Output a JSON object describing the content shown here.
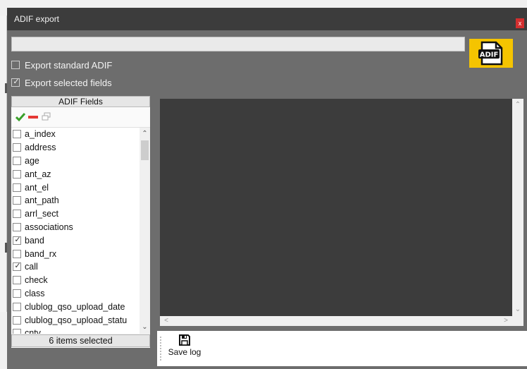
{
  "window": {
    "title": "ADIF export",
    "close_label": "x"
  },
  "logo": {
    "text": "ADIF"
  },
  "options": {
    "standard": {
      "label": "Export standard ADIF",
      "checked": false
    },
    "selected": {
      "label": "Export selected fields",
      "checked": true
    }
  },
  "fields": {
    "header": "ADIF Fields",
    "toolbar_icons": [
      "check-all-icon",
      "uncheck-all-icon",
      "copy-icon"
    ],
    "items": [
      {
        "label": "a_index",
        "checked": false
      },
      {
        "label": "address",
        "checked": false
      },
      {
        "label": "age",
        "checked": false
      },
      {
        "label": "ant_az",
        "checked": false
      },
      {
        "label": "ant_el",
        "checked": false
      },
      {
        "label": "ant_path",
        "checked": false
      },
      {
        "label": "arrl_sect",
        "checked": false
      },
      {
        "label": "associations",
        "checked": false
      },
      {
        "label": "band",
        "checked": true
      },
      {
        "label": "band_rx",
        "checked": false
      },
      {
        "label": "call",
        "checked": true
      },
      {
        "label": "check",
        "checked": false
      },
      {
        "label": "class",
        "checked": false
      },
      {
        "label": "clublog_qso_upload_date",
        "checked": false
      },
      {
        "label": "clublog_qso_upload_statu",
        "checked": false
      },
      {
        "label": "cnty",
        "checked": false
      }
    ],
    "status": "6 items selected"
  },
  "toolbar": {
    "save_label": "Save log"
  },
  "colors": {
    "titlebar": "#3c3c3c",
    "dialog_bg": "#6d6d6d",
    "close": "#d32f2f",
    "logo_bg": "#f5c400",
    "check_green": "#3aa02a",
    "uncheck_red": "#e53935",
    "preview_bg": "#3c3c3c"
  }
}
